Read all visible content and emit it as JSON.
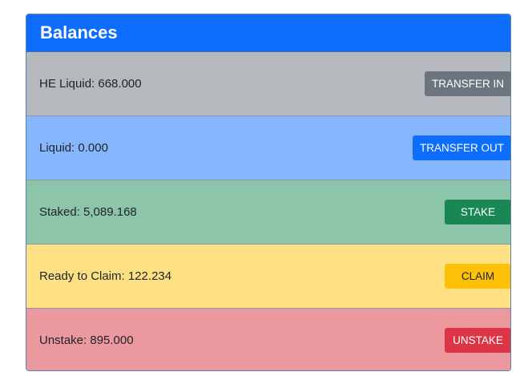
{
  "card": {
    "title": "Balances"
  },
  "rows": [
    {
      "label": "HE Liquid: 668.000",
      "button": "TRANSFER IN"
    },
    {
      "label": "Liquid: 0.000",
      "button": "TRANSFER OUT"
    },
    {
      "label": "Staked: 5,089.168",
      "button": "STAKE"
    },
    {
      "label": "Ready to Claim: 122.234",
      "button": "CLAIM"
    },
    {
      "label": "Unstake: 895.000",
      "button": "UNSTAKE"
    }
  ],
  "colors": {
    "header": "#0d6efd",
    "he_liquid_row": "#b5b8bc",
    "liquid_row": "#86b6fe",
    "staked_row": "#8cc5a9",
    "claim_row": "#ffe083",
    "unstake_row": "#eb989e",
    "transfer_in_button": "#6c757d",
    "transfer_out_button": "#0d6efd",
    "stake_button": "#198754",
    "claim_button": "#ffc107",
    "unstake_button": "#dc3545"
  }
}
